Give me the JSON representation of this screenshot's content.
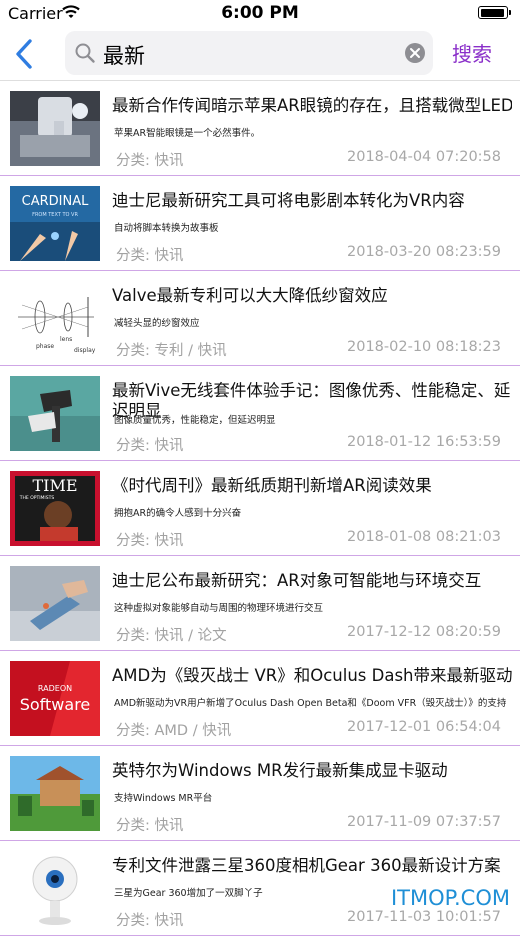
{
  "status": {
    "carrier": "Carrier",
    "time": "6:00 PM"
  },
  "nav": {
    "query": "最新",
    "search_label": "搜索"
  },
  "articles": [
    {
      "title": "最新合作传闻暗示苹果AR眼镜的存在，且搭载微型LED",
      "desc": "苹果AR智能眼镜是一个必然事件。",
      "category": "分类: 快讯",
      "date": "2018-04-04 07:20:58"
    },
    {
      "title": "迪士尼最新研究工具可将电影剧本转化为VR内容",
      "desc": "自动将脚本转换为故事板",
      "category": "分类: 快讯",
      "date": "2018-03-20 08:23:59"
    },
    {
      "title": "Valve最新专利可以大大降低纱窗效应",
      "desc": "减轻头显的纱窗效应",
      "category": "分类: 专利 / 快讯",
      "date": "2018-02-10 08:18:23"
    },
    {
      "title": "最新Vive无线套件体验手记：图像优秀、性能稳定、延迟明显",
      "desc": "图像质量优秀，性能稳定，但延迟明显",
      "category": "分类: 快讯",
      "date": "2018-01-12 16:53:59"
    },
    {
      "title": "《时代周刊》最新纸质期刊新增AR阅读效果",
      "desc": "拥抱AR的确令人感到十分兴奋",
      "category": "分类: 快讯",
      "date": "2018-01-08 08:21:03"
    },
    {
      "title": "迪士尼公布最新研究：AR对象可智能地与环境交互",
      "desc": "这种虚拟对象能够自动与周围的物理环境进行交互",
      "category": "分类: 快讯 / 论文",
      "date": "2017-12-12 08:20:59"
    },
    {
      "title": "AMD为《毁灭战士 VR》和Oculus Dash带来最新驱动",
      "desc": "AMD新驱动为VR用户新增了Oculus Dash Open Beta和《Doom VFR（毁灭战士）》的支持",
      "category": "分类: AMD / 快讯",
      "date": "2017-12-01 06:54:04"
    },
    {
      "title": "英特尔为Windows MR发行最新集成显卡驱动",
      "desc": "支持Windows MR平台",
      "category": "分类: 快讯",
      "date": "2017-11-09 07:37:57"
    },
    {
      "title": "专利文件泄露三星360度相机Gear 360最新设计方案",
      "desc": "三星为Gear 360增加了一双脚丫子",
      "category": "分类: 快讯",
      "date": "2017-11-03 10:01:57"
    }
  ],
  "thumbs": {
    "t2_text": "CARDINAL",
    "t2_sub": "FROM TEXT TO VR",
    "t3_labels": [
      "phase",
      "lens",
      "display"
    ],
    "t5_text": "TIME",
    "t5_sub": "THE OPTIMISTS",
    "t7_top": "RADEON",
    "t7_main": "Software"
  },
  "watermark": "ITMOP.COM",
  "colors": {
    "accent": "#8a2fc9",
    "separator": "#cfa6e6",
    "back": "#2f7de1"
  }
}
